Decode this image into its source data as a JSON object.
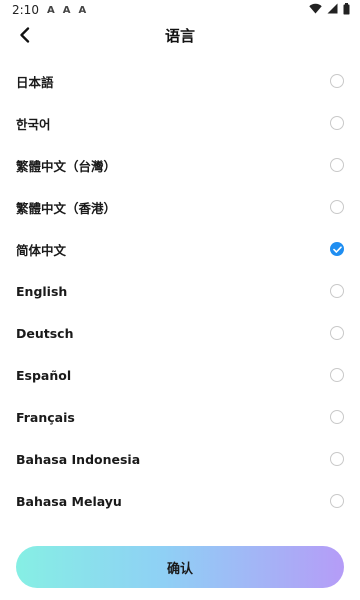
{
  "status_bar": {
    "time": "2:10",
    "notification_icons": [
      "A",
      "A",
      "A"
    ]
  },
  "header": {
    "title": "语言"
  },
  "languages": [
    {
      "label": "日本語",
      "selected": false
    },
    {
      "label": "한국어",
      "selected": false
    },
    {
      "label": "繁體中文（台灣）",
      "selected": false
    },
    {
      "label": "繁體中文（香港）",
      "selected": false
    },
    {
      "label": "简体中文",
      "selected": true
    },
    {
      "label": "English",
      "selected": false
    },
    {
      "label": "Deutsch",
      "selected": false
    },
    {
      "label": "Español",
      "selected": false
    },
    {
      "label": "Français",
      "selected": false
    },
    {
      "label": "Bahasa Indonesia",
      "selected": false
    },
    {
      "label": "Bahasa Melayu",
      "selected": false
    }
  ],
  "confirm_button": {
    "label": "确认"
  },
  "colors": {
    "accent": "#1f8ef1",
    "radio_border": "#c9c9c9",
    "button_gradient_start": "#86efe4",
    "button_gradient_end": "#b59cf7"
  }
}
